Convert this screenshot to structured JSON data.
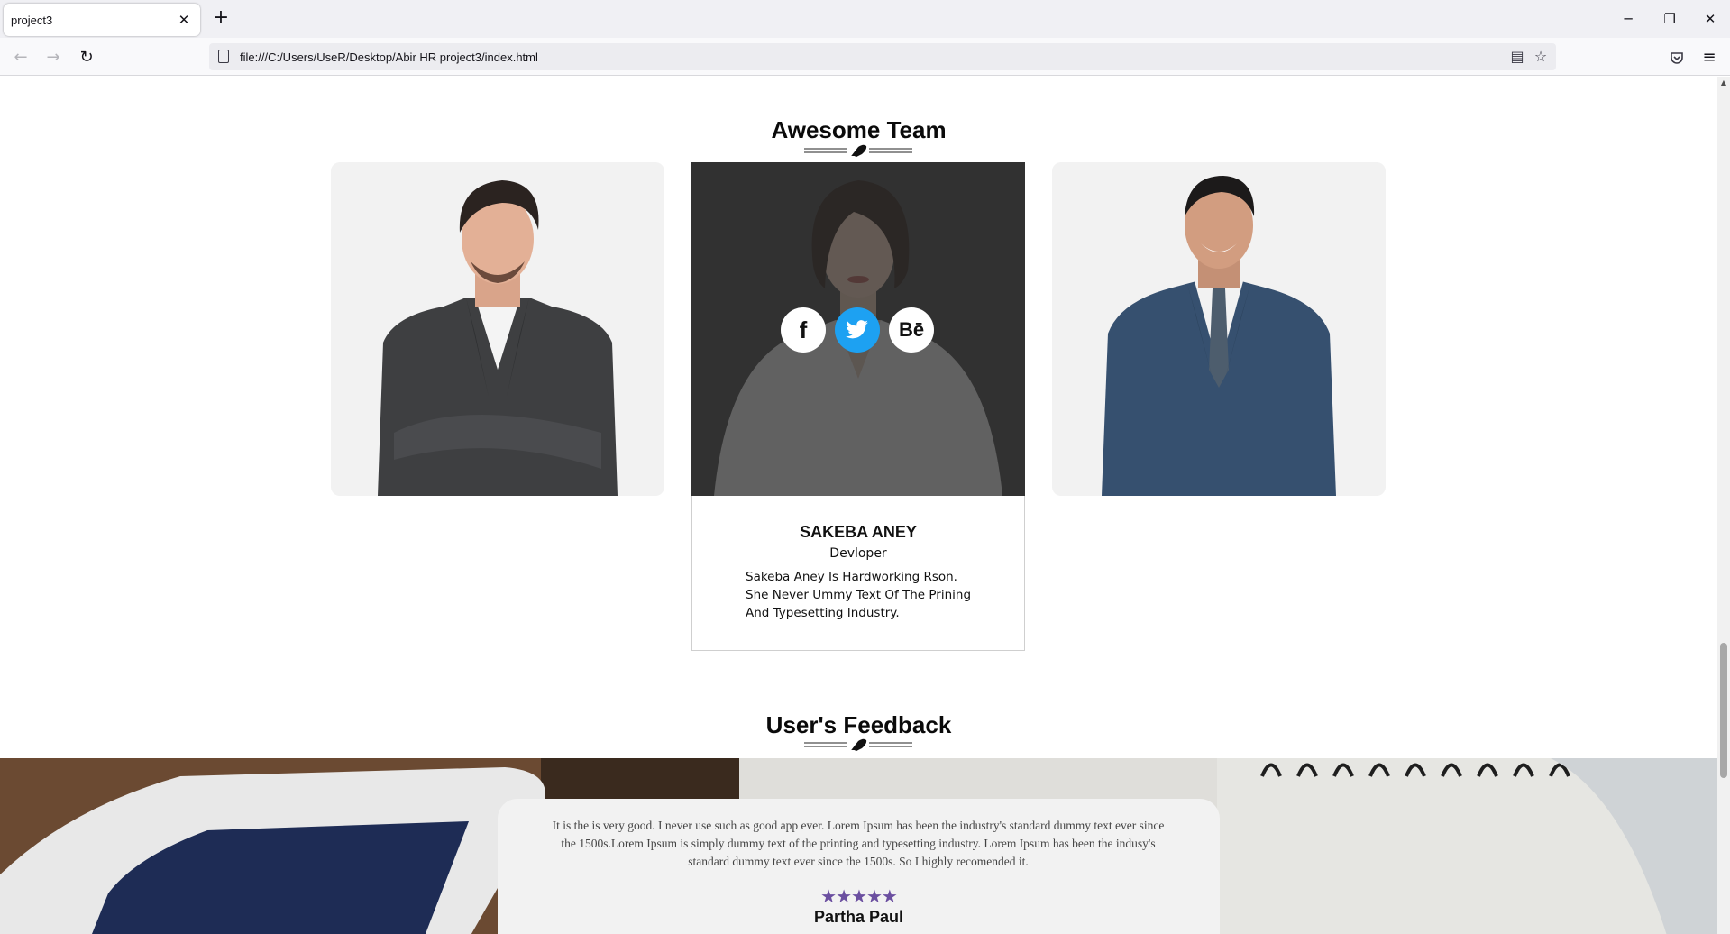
{
  "browser": {
    "tab_title": "project3",
    "tab_close": "✕",
    "new_tab": "+",
    "url": "file:///C:/Users/UseR/Desktop/Abir HR project3/index.html",
    "window_minimize": "─",
    "window_restore": "❐",
    "window_close": "✕"
  },
  "team": {
    "title": "Awesome Team",
    "members": [
      {
        "image": "man-grey-suit-arms-crossed"
      },
      {
        "image": "woman-white-blouse",
        "name": "SAKEBA ANEY",
        "role": "Devloper",
        "bio": "Sakeba Aney Is Hardworking Rson. She Never Ummy Text Of The Prining And Typesetting Industry."
      },
      {
        "image": "man-blue-suit-smiling"
      }
    ],
    "social": {
      "facebook": "f",
      "twitter": "twitter-bird",
      "behance": "Bē"
    }
  },
  "feedback": {
    "title": "User's Feedback",
    "text": "It is the is very good. I never use such as good app ever. Lorem Ipsum has been the industry's standard dummy text ever since the 1500s.Lorem Ipsum is simply dummy text of the printing and typesetting industry. Lorem Ipsum has been the indusy's standard dummy text ever since the 1500s. So I highly recomended it.",
    "rating": 4.5,
    "stars": "★★★★★",
    "reviewer": "Partha Paul"
  },
  "colors": {
    "star": "#6b4fa0",
    "twitter": "#1da1f2",
    "overlay": "#2d2d2d"
  }
}
